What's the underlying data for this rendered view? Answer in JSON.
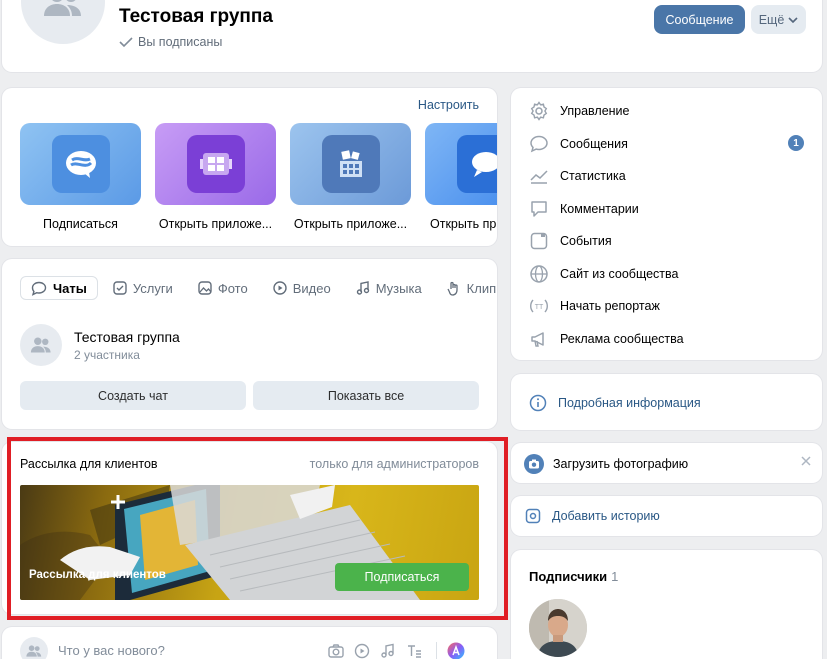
{
  "header": {
    "group_title": "Тестовая группа",
    "subscription_status": "Вы подписаны",
    "message_button": "Сообщение",
    "more_button": "Ещё"
  },
  "apps": {
    "configure_link": "Настроить",
    "items": [
      {
        "label": "Подписаться",
        "icon": "subscribe-bubble-icon"
      },
      {
        "label": "Открыть приложе...",
        "icon": "app-grid-icon"
      },
      {
        "label": "Открыть приложе...",
        "icon": "app-blocks-icon"
      },
      {
        "label": "Открыть при",
        "icon": "chat-bubble-icon"
      }
    ]
  },
  "content_tabs": [
    {
      "label": "Чаты",
      "icon": "chat-icon"
    },
    {
      "label": "Услуги",
      "icon": "services-icon"
    },
    {
      "label": "Фото",
      "icon": "photo-icon"
    },
    {
      "label": "Видео",
      "icon": "video-icon"
    },
    {
      "label": "Музыка",
      "icon": "music-icon"
    },
    {
      "label": "Клипы",
      "icon": "clips-icon"
    }
  ],
  "chat": {
    "name": "Тестовая группа",
    "members": "2 участника",
    "create_button": "Создать чат",
    "show_all_button": "Показать все"
  },
  "mailing": {
    "title": "Рассылка для клиентов",
    "admin_note": "только для администраторов",
    "banner_text": "Рассылка для клиентов",
    "subscribe_button": "Подписаться"
  },
  "post": {
    "placeholder": "Что у вас нового?"
  },
  "menu": {
    "items": [
      {
        "label": "Управление",
        "icon": "gear-icon"
      },
      {
        "label": "Сообщения",
        "icon": "message-icon"
      },
      {
        "label": "Статистика",
        "icon": "stats-icon"
      },
      {
        "label": "Комментарии",
        "icon": "comment-icon"
      },
      {
        "label": "События",
        "icon": "events-icon"
      },
      {
        "label": "Сайт из сообщества",
        "icon": "globe-icon"
      },
      {
        "label": "Начать репортаж",
        "icon": "live-icon"
      },
      {
        "label": "Реклама сообщества",
        "icon": "megaphone-icon"
      }
    ],
    "messages_badge": "1"
  },
  "info": {
    "label": "Подробная информация"
  },
  "upload": {
    "label": "Загрузить фотографию"
  },
  "story": {
    "label": "Добавить историю"
  },
  "subscribers": {
    "title": "Подписчики",
    "count": "1"
  },
  "colors": {
    "primary_button": "#4a76a8",
    "link": "#2a5885",
    "subscribe_green": "#4bb34b",
    "highlight_red": "#e01e25"
  }
}
